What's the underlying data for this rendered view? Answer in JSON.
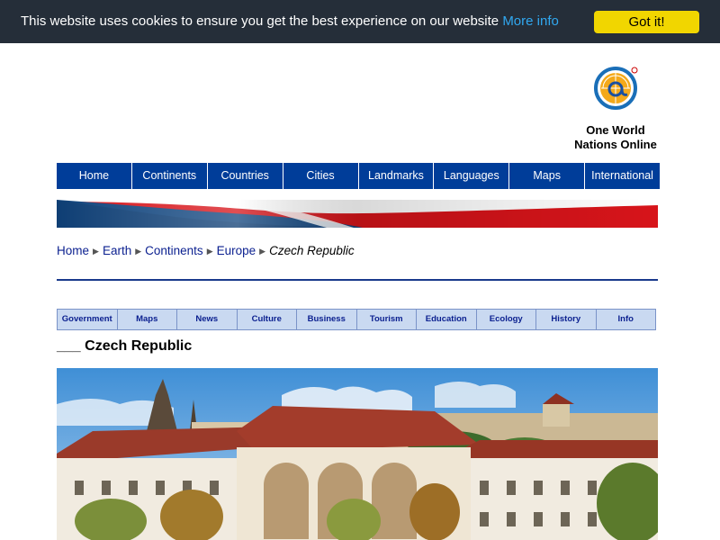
{
  "cookie_banner": {
    "message": "This website uses cookies to ensure you get the best experience on our website",
    "more_info": "More info",
    "button": "Got it!"
  },
  "logo": {
    "line1": "One World",
    "line2": "Nations Online"
  },
  "main_nav": [
    {
      "label": "Home"
    },
    {
      "label": "Continents"
    },
    {
      "label": "Countries"
    },
    {
      "label": "Cities"
    },
    {
      "label": "Landmarks"
    },
    {
      "label": "Languages"
    },
    {
      "label": "Maps"
    },
    {
      "label": "International"
    }
  ],
  "breadcrumb": [
    {
      "label": "Home"
    },
    {
      "label": "Earth"
    },
    {
      "label": "Continents"
    },
    {
      "label": "Europe"
    }
  ],
  "breadcrumb_current": "Czech Republic",
  "sub_nav": [
    {
      "label": "Government"
    },
    {
      "label": "Maps"
    },
    {
      "label": "News"
    },
    {
      "label": "Culture"
    },
    {
      "label": "Business"
    },
    {
      "label": "Tourism"
    },
    {
      "label": "Education"
    },
    {
      "label": "Ecology"
    },
    {
      "label": "History"
    },
    {
      "label": "Info"
    }
  ],
  "page_title": "___ Czech Republic",
  "colors": {
    "cookie_bg": "#252e39",
    "cookie_button": "#f1d600",
    "nav_bg": "#003d99",
    "subnav_bg": "#c9d9f1",
    "link": "#0a1f8f"
  }
}
